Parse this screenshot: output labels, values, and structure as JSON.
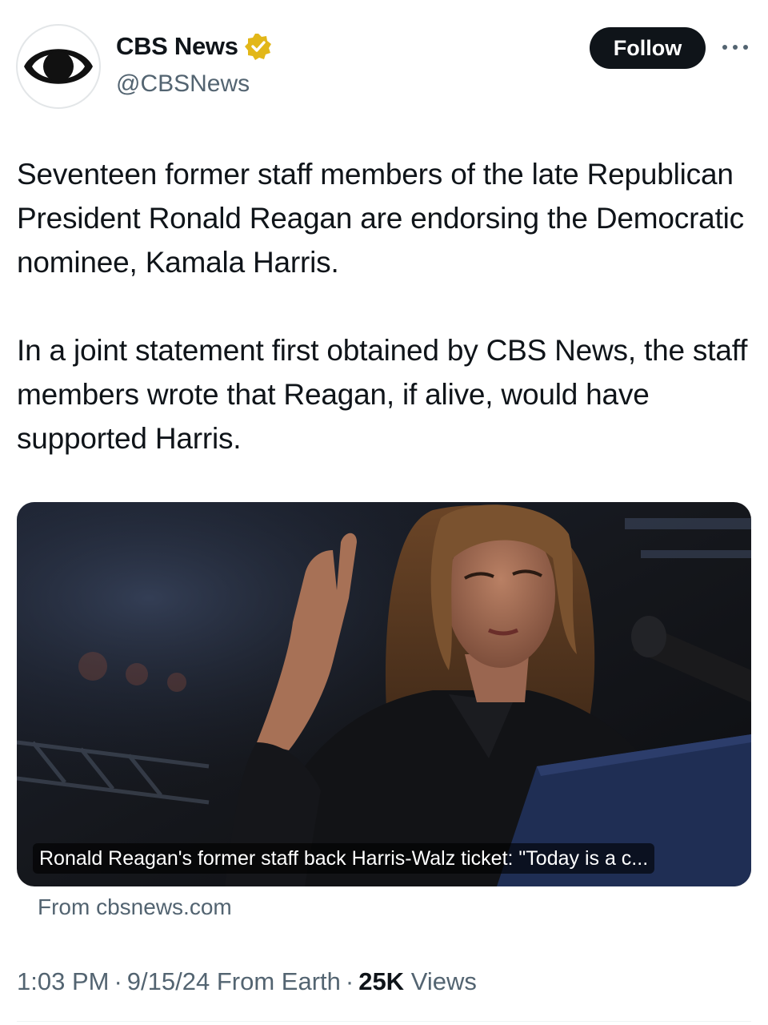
{
  "account": {
    "display_name": "CBS News",
    "handle": "@CBSNews",
    "avatar_icon": "cbs-eye-logo",
    "verified_icon": "gold-verified-badge",
    "verified_color": "#e2b719"
  },
  "actions": {
    "follow_label": "Follow",
    "more_icon": "more-horizontal-icon"
  },
  "tweet": {
    "paragraphs": [
      "Seventeen former staff members of the late Republican President Ronald Reagan are endorsing the Democratic nominee, Kamala Harris.",
      "In a joint statement first obtained by CBS News, the staff members wrote that Reagan, if alive, would have supported Harris."
    ]
  },
  "link_card": {
    "caption": "Ronald Reagan's former staff back Harris-Walz ticket: \"Today is a c...",
    "source": "From cbsnews.com"
  },
  "meta": {
    "time": "1:03 PM",
    "separator": "·",
    "date": "9/15/24",
    "client": "From Earth",
    "views_count": "25K",
    "views_label": "Views"
  },
  "colors": {
    "text_primary": "#0f1419",
    "text_secondary": "#536471",
    "follow_bg": "#0f1419"
  }
}
